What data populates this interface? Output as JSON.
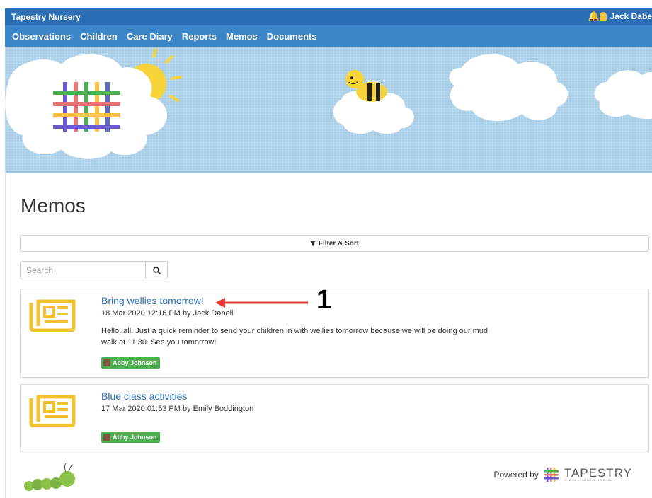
{
  "topbar": {
    "app_name": "Tapestry Nursery",
    "user_name": "Jack Dabe"
  },
  "nav": [
    "Observations",
    "Children",
    "Care Diary",
    "Reports",
    "Memos",
    "Documents"
  ],
  "page": {
    "title": "Memos",
    "filter_label": "Filter & Sort",
    "search_placeholder": "Search"
  },
  "memos": [
    {
      "title": "Bring wellies tomorrow!",
      "meta": "18 Mar 2020 12:16 PM by Jack Dabell",
      "body": "Hello, all. Just a quick reminder to send your children in with wellies tomorrow because we will be doing our mud walk at 11:30. See you tomorrow!",
      "tag": "Abby Johnson"
    },
    {
      "title": "Blue class activities",
      "meta": "17 Mar 2020 01:53 PM by Emily Boddington",
      "body": "",
      "tag": "Abby Johnson"
    }
  ],
  "annotation": {
    "number": "1"
  },
  "footer": {
    "powered_by": "Powered by",
    "logo_text": "TAPESTRY",
    "logo_subtitle": "ONLINE LEARNING JOURNAL"
  },
  "colors": {
    "topbar": "#2a6fb5",
    "nav": "#3a86c8",
    "link": "#2a6fb5",
    "memo_icon": "#f2c12e",
    "tag": "#4caf50",
    "annotation_arrow": "#e53935"
  }
}
